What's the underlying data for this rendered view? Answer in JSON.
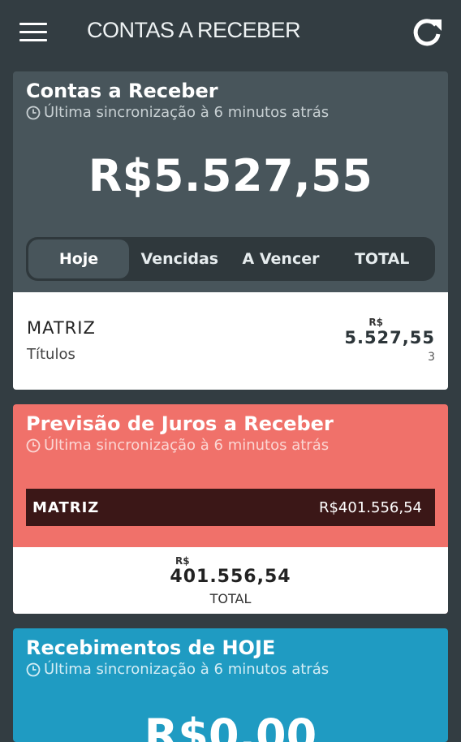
{
  "header": {
    "title": "CONTAS A RECEBER",
    "menu_icon": "hamburger-menu-icon",
    "refresh_icon": "refresh-icon"
  },
  "receivables": {
    "title": "Contas a Receber",
    "sync_text": "Última sincronização à 6 minutos atrás",
    "amount": "R$5.527,55",
    "tabs": [
      {
        "label": "Hoje",
        "active": true
      },
      {
        "label": "Vencidas"
      },
      {
        "label": "A Vencer"
      },
      {
        "label": "TOTAL"
      }
    ],
    "row": {
      "name": "MATRIZ",
      "subtitle": "Títulos",
      "currency": "R$",
      "value": "5.527,55",
      "count": "3"
    },
    "color": "#48555b"
  },
  "interest": {
    "title": "Previsão de Juros a Receber",
    "sync_text": "Última sincronização à 6 minutos atrás",
    "row": {
      "name": "MATRIZ",
      "value": "R$401.556,54"
    },
    "total_currency": "R$",
    "total_value": "401.556,54",
    "total_label": "TOTAL",
    "color": "#f0716a"
  },
  "today": {
    "title": "Recebimentos de HOJE",
    "sync_text": "Última sincronização à 6 minutos atrás",
    "amount": "R$0,00",
    "color": "#1f9bc2"
  }
}
